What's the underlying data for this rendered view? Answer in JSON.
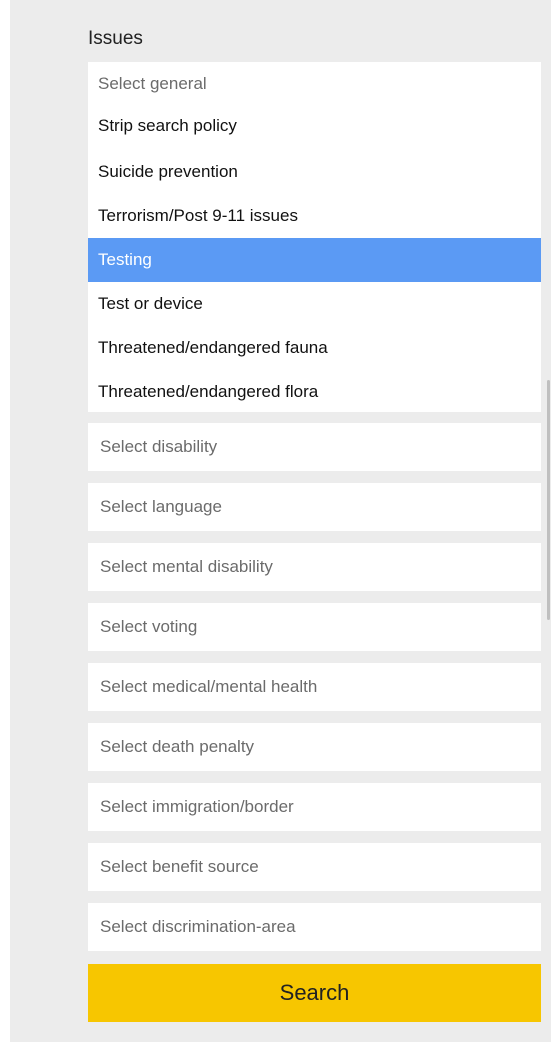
{
  "issues_label": "Issues",
  "general_dropdown": {
    "placeholder": "Select general",
    "options": [
      "Strip search policy",
      "Suicide prevention",
      "Terrorism/Post 9-11 issues",
      "Testing",
      "Test or device",
      "Threatened/endangered fauna",
      "Threatened/endangered flora"
    ],
    "selected": "Testing"
  },
  "selects": [
    "Select disability",
    "Select language",
    "Select mental disability",
    "Select voting",
    "Select medical/mental health",
    "Select death penalty",
    "Select immigration/border",
    "Select benefit source",
    "Select discrimination-area"
  ],
  "search_button": {
    "label": "Search",
    "color": "#f7c600"
  },
  "colors": {
    "selected_option": "#5b9af4",
    "panel_background": "#ececec"
  }
}
